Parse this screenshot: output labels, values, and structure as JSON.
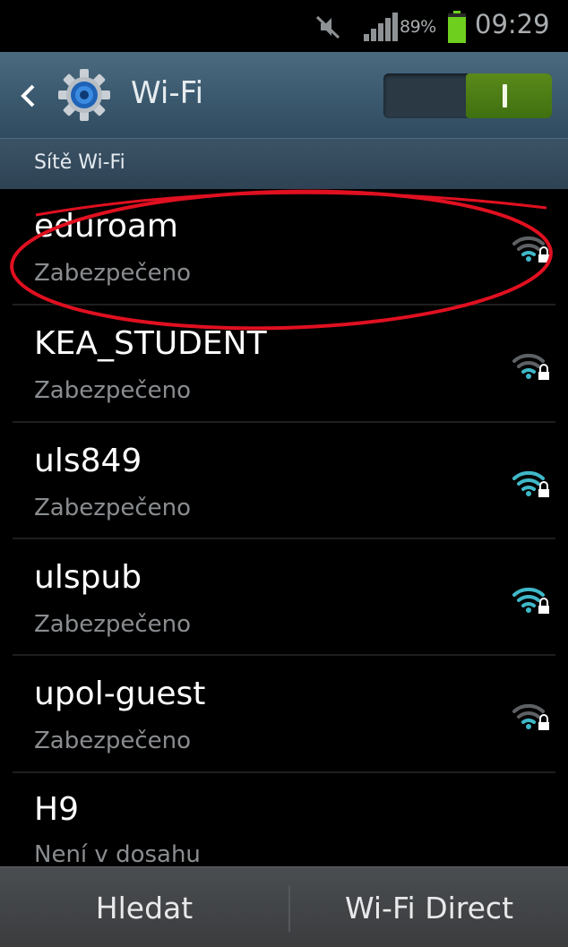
{
  "status_bar": {
    "battery_percent": "89%",
    "battery_level": 0.89,
    "clock": "09:29",
    "icons": [
      "mute-icon",
      "signal-icon",
      "battery-icon"
    ]
  },
  "action_bar": {
    "title": "Wi-Fi",
    "wifi_enabled": true,
    "icons": [
      "back-icon",
      "settings-gear-icon"
    ]
  },
  "section": {
    "label": "Sítě Wi-Fi"
  },
  "networks": [
    {
      "ssid": "eduroam",
      "status": "Zabezpečeno",
      "signal_level": 1,
      "secured": true
    },
    {
      "ssid": "KEA_STUDENT",
      "status": "Zabezpečeno",
      "signal_level": 1,
      "secured": true
    },
    {
      "ssid": "uls849",
      "status": "Zabezpečeno",
      "signal_level": 3,
      "secured": true
    },
    {
      "ssid": "ulspub",
      "status": "Zabezpečeno",
      "signal_level": 3,
      "secured": true
    },
    {
      "ssid": "upol-guest",
      "status": "Zabezpečeno",
      "signal_level": 1,
      "secured": true
    },
    {
      "ssid": "H9",
      "status": "Není v dosahu",
      "signal_level": 0,
      "secured": false
    }
  ],
  "bottom_bar": {
    "scan_label": "Hledat",
    "direct_label": "Wi-Fi Direct"
  },
  "colors": {
    "action_bar": "#3c5a6f",
    "toggle_on": "#4a7d14",
    "signal_active": "#3fb8c8",
    "signal_inactive": "#5e6164",
    "annotation": "#e01020"
  }
}
